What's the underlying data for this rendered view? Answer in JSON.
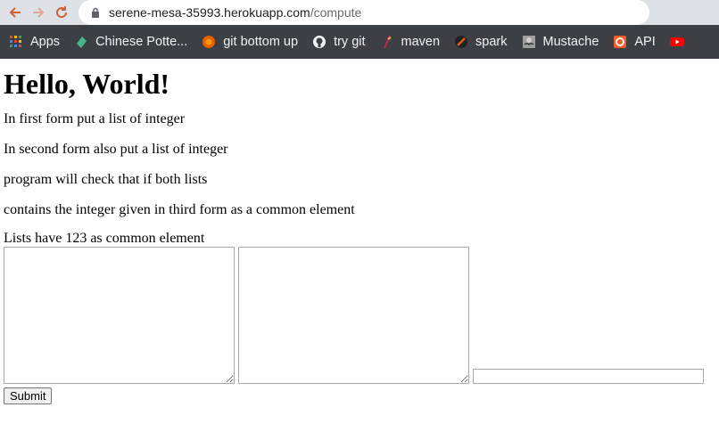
{
  "browser": {
    "url_host": "serene-mesa-35993.herokuapp.com",
    "url_path": "/compute"
  },
  "bookmarks": [
    {
      "label": "Apps",
      "icon": "apps-grid-icon"
    },
    {
      "label": "Chinese Potte...",
      "icon": "gem-icon"
    },
    {
      "label": "git bottom up",
      "icon": "firefox-icon"
    },
    {
      "label": "try git",
      "icon": "github-icon"
    },
    {
      "label": "maven",
      "icon": "feather-icon"
    },
    {
      "label": "spark",
      "icon": "spark-icon"
    },
    {
      "label": "Mustache",
      "icon": "mustache-icon"
    },
    {
      "label": "API",
      "icon": "api-icon"
    }
  ],
  "page": {
    "heading": "Hello, World!",
    "lines": [
      "In first form put a list of integer",
      "In second form also put a list of integer",
      "program will check that if both lists",
      "contains the integer given in third form as a common element"
    ],
    "result": "Lists have 123 as common element",
    "form": {
      "list1_value": "",
      "list2_value": "",
      "element_value": "",
      "submit_label": "Submit"
    }
  }
}
